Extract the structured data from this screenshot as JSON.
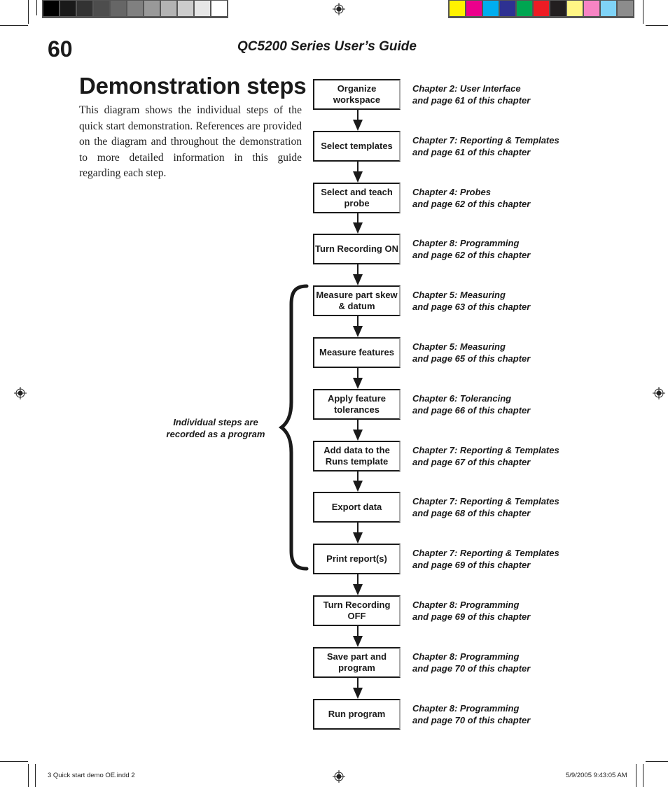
{
  "header": {
    "page_number": "60",
    "running_head": "QC5200 Series User’s Guide"
  },
  "section": {
    "title": "Demonstration steps",
    "intro": "This diagram shows the individual steps of the quick start demonstration.  References are provided on the diagram and throughout the demonstration to more detailed information in this guide regarding each step."
  },
  "flowchart": {
    "steps": [
      {
        "label": "Organize workspace",
        "ref_chapter": "Chapter 2:  User Interface",
        "ref_page": "and page 61 of this chapter"
      },
      {
        "label": "Select templates",
        "ref_chapter": "Chapter 7:  Reporting & Templates",
        "ref_page": "and page 61 of this chapter"
      },
      {
        "label": "Select and teach probe",
        "ref_chapter": "Chapter 4:  Probes",
        "ref_page": "and page 62 of this chapter"
      },
      {
        "label": "Turn Recording ON",
        "ref_chapter": "Chapter 8:  Programming",
        "ref_page": "and page 62 of this chapter"
      },
      {
        "label": "Measure part skew & datum",
        "ref_chapter": "Chapter 5:  Measuring",
        "ref_page": "and page 63 of this chapter"
      },
      {
        "label": "Measure features",
        "ref_chapter": "Chapter 5:  Measuring",
        "ref_page": "and page 65 of this chapter"
      },
      {
        "label": "Apply feature tolerances",
        "ref_chapter": "Chapter 6:  Tolerancing",
        "ref_page": "and page 66 of this chapter"
      },
      {
        "label": "Add data to the Runs template",
        "ref_chapter": "Chapter 7:  Reporting & Templates",
        "ref_page": "and page 67 of this chapter"
      },
      {
        "label": "Export data",
        "ref_chapter": "Chapter 7:  Reporting & Templates",
        "ref_page": "and page 68 of this chapter"
      },
      {
        "label": "Print report(s)",
        "ref_chapter": "Chapter 7:  Reporting & Templates",
        "ref_page": "and page 69 of this chapter"
      },
      {
        "label": "Turn Recording OFF",
        "ref_chapter": "Chapter 8:  Programming",
        "ref_page": "and page 69 of this chapter"
      },
      {
        "label": "Save part and program",
        "ref_chapter": "Chapter 8:  Programming",
        "ref_page": "and page 70 of this chapter"
      },
      {
        "label": "Run program",
        "ref_chapter": "Chapter 8:  Programming",
        "ref_page": "and page 70 of this chapter"
      }
    ],
    "brace_note_line1": "Individual steps are",
    "brace_note_line2": "recorded as a program"
  },
  "print_marks": {
    "gray_swatches": [
      "#000000",
      "#1a1a1a",
      "#333333",
      "#4d4d4d",
      "#666666",
      "#808080",
      "#999999",
      "#b3b3b3",
      "#cccccc",
      "#e6e6e6",
      "#ffffff"
    ],
    "color_swatches": [
      "#fff200",
      "#ec008c",
      "#00aeef",
      "#2e3192",
      "#00a651",
      "#ed1c24",
      "#231f20",
      "#fff685",
      "#f784c4",
      "#7fd3f7",
      "#8c8c8c"
    ],
    "slug_file": "3 Quick start demo OE.indd   2",
    "slug_timestamp": "5/9/2005   9:43:05 AM"
  }
}
